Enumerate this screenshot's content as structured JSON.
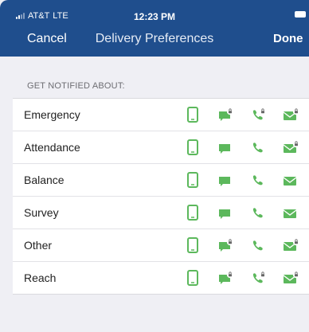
{
  "status_bar": {
    "carrier": "AT&T",
    "network": "LTE",
    "time": "12:23 PM"
  },
  "nav": {
    "cancel": "Cancel",
    "title": "Delivery Preferences",
    "done": "Done"
  },
  "section_header": "GET NOTIFIED ABOUT:",
  "colors": {
    "accent_green": "#5cb85c",
    "nav_blue": "#1f4e8d"
  },
  "rows": [
    {
      "label": "Emergency",
      "icons": [
        "mobile-icon",
        "chat-locked-icon",
        "phone-locked-icon",
        "mail-locked-icon"
      ]
    },
    {
      "label": "Attendance",
      "icons": [
        "mobile-icon",
        "chat-icon",
        "phone-icon",
        "mail-locked-icon"
      ]
    },
    {
      "label": "Balance",
      "icons": [
        "mobile-icon",
        "chat-icon",
        "phone-icon",
        "mail-icon"
      ]
    },
    {
      "label": "Survey",
      "icons": [
        "mobile-icon",
        "chat-icon",
        "phone-icon",
        "mail-icon"
      ]
    },
    {
      "label": "Other",
      "icons": [
        "mobile-icon",
        "chat-locked-icon",
        "phone-icon",
        "mail-locked-icon"
      ]
    },
    {
      "label": "Reach",
      "icons": [
        "mobile-icon",
        "chat-locked-icon",
        "phone-locked-icon",
        "mail-locked-icon"
      ]
    }
  ]
}
